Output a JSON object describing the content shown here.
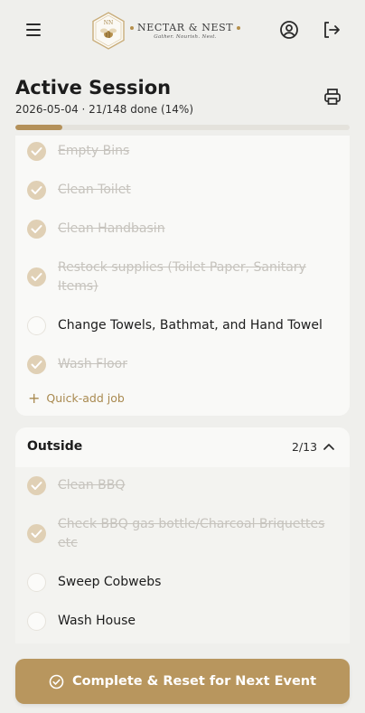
{
  "header": {
    "brand_name": "NECTAR & NEST",
    "brand_tagline": "Gather. Nourish. Nest.",
    "icons": [
      "menu-icon",
      "user-icon",
      "logout-icon"
    ]
  },
  "session": {
    "title": "Active Session",
    "meta": "2026-05-04 · 21/148 done (14%)",
    "progress_fraction": 0.14
  },
  "sections": [
    {
      "tasks": [
        {
          "label": "Empty Bins",
          "done": true
        },
        {
          "label": "Clean Toilet",
          "done": true
        },
        {
          "label": "Clean Handbasin",
          "done": true
        },
        {
          "label": "Restock supplies (Toilet Paper, Sanitary Items)",
          "done": true
        },
        {
          "label": "Change Towels, Bathmat, and Hand Towel",
          "done": false
        },
        {
          "label": "Wash Floor",
          "done": true
        }
      ],
      "quick_add_label": "Quick-add job"
    },
    {
      "title": "Outside",
      "count": "2/13",
      "tasks": [
        {
          "label": "Clean BBQ",
          "done": true
        },
        {
          "label": "Check BBQ gas bottle/Charcoal Briquettes etc",
          "done": true
        },
        {
          "label": "Sweep Cobwebs",
          "done": false
        },
        {
          "label": "Wash House",
          "done": false
        }
      ]
    }
  ],
  "footer": {
    "complete_label": "Complete & Reset for Next Event"
  },
  "colors": {
    "accent": "#b8965e",
    "done_check": "#e0d0b5",
    "background": "#efefec"
  }
}
